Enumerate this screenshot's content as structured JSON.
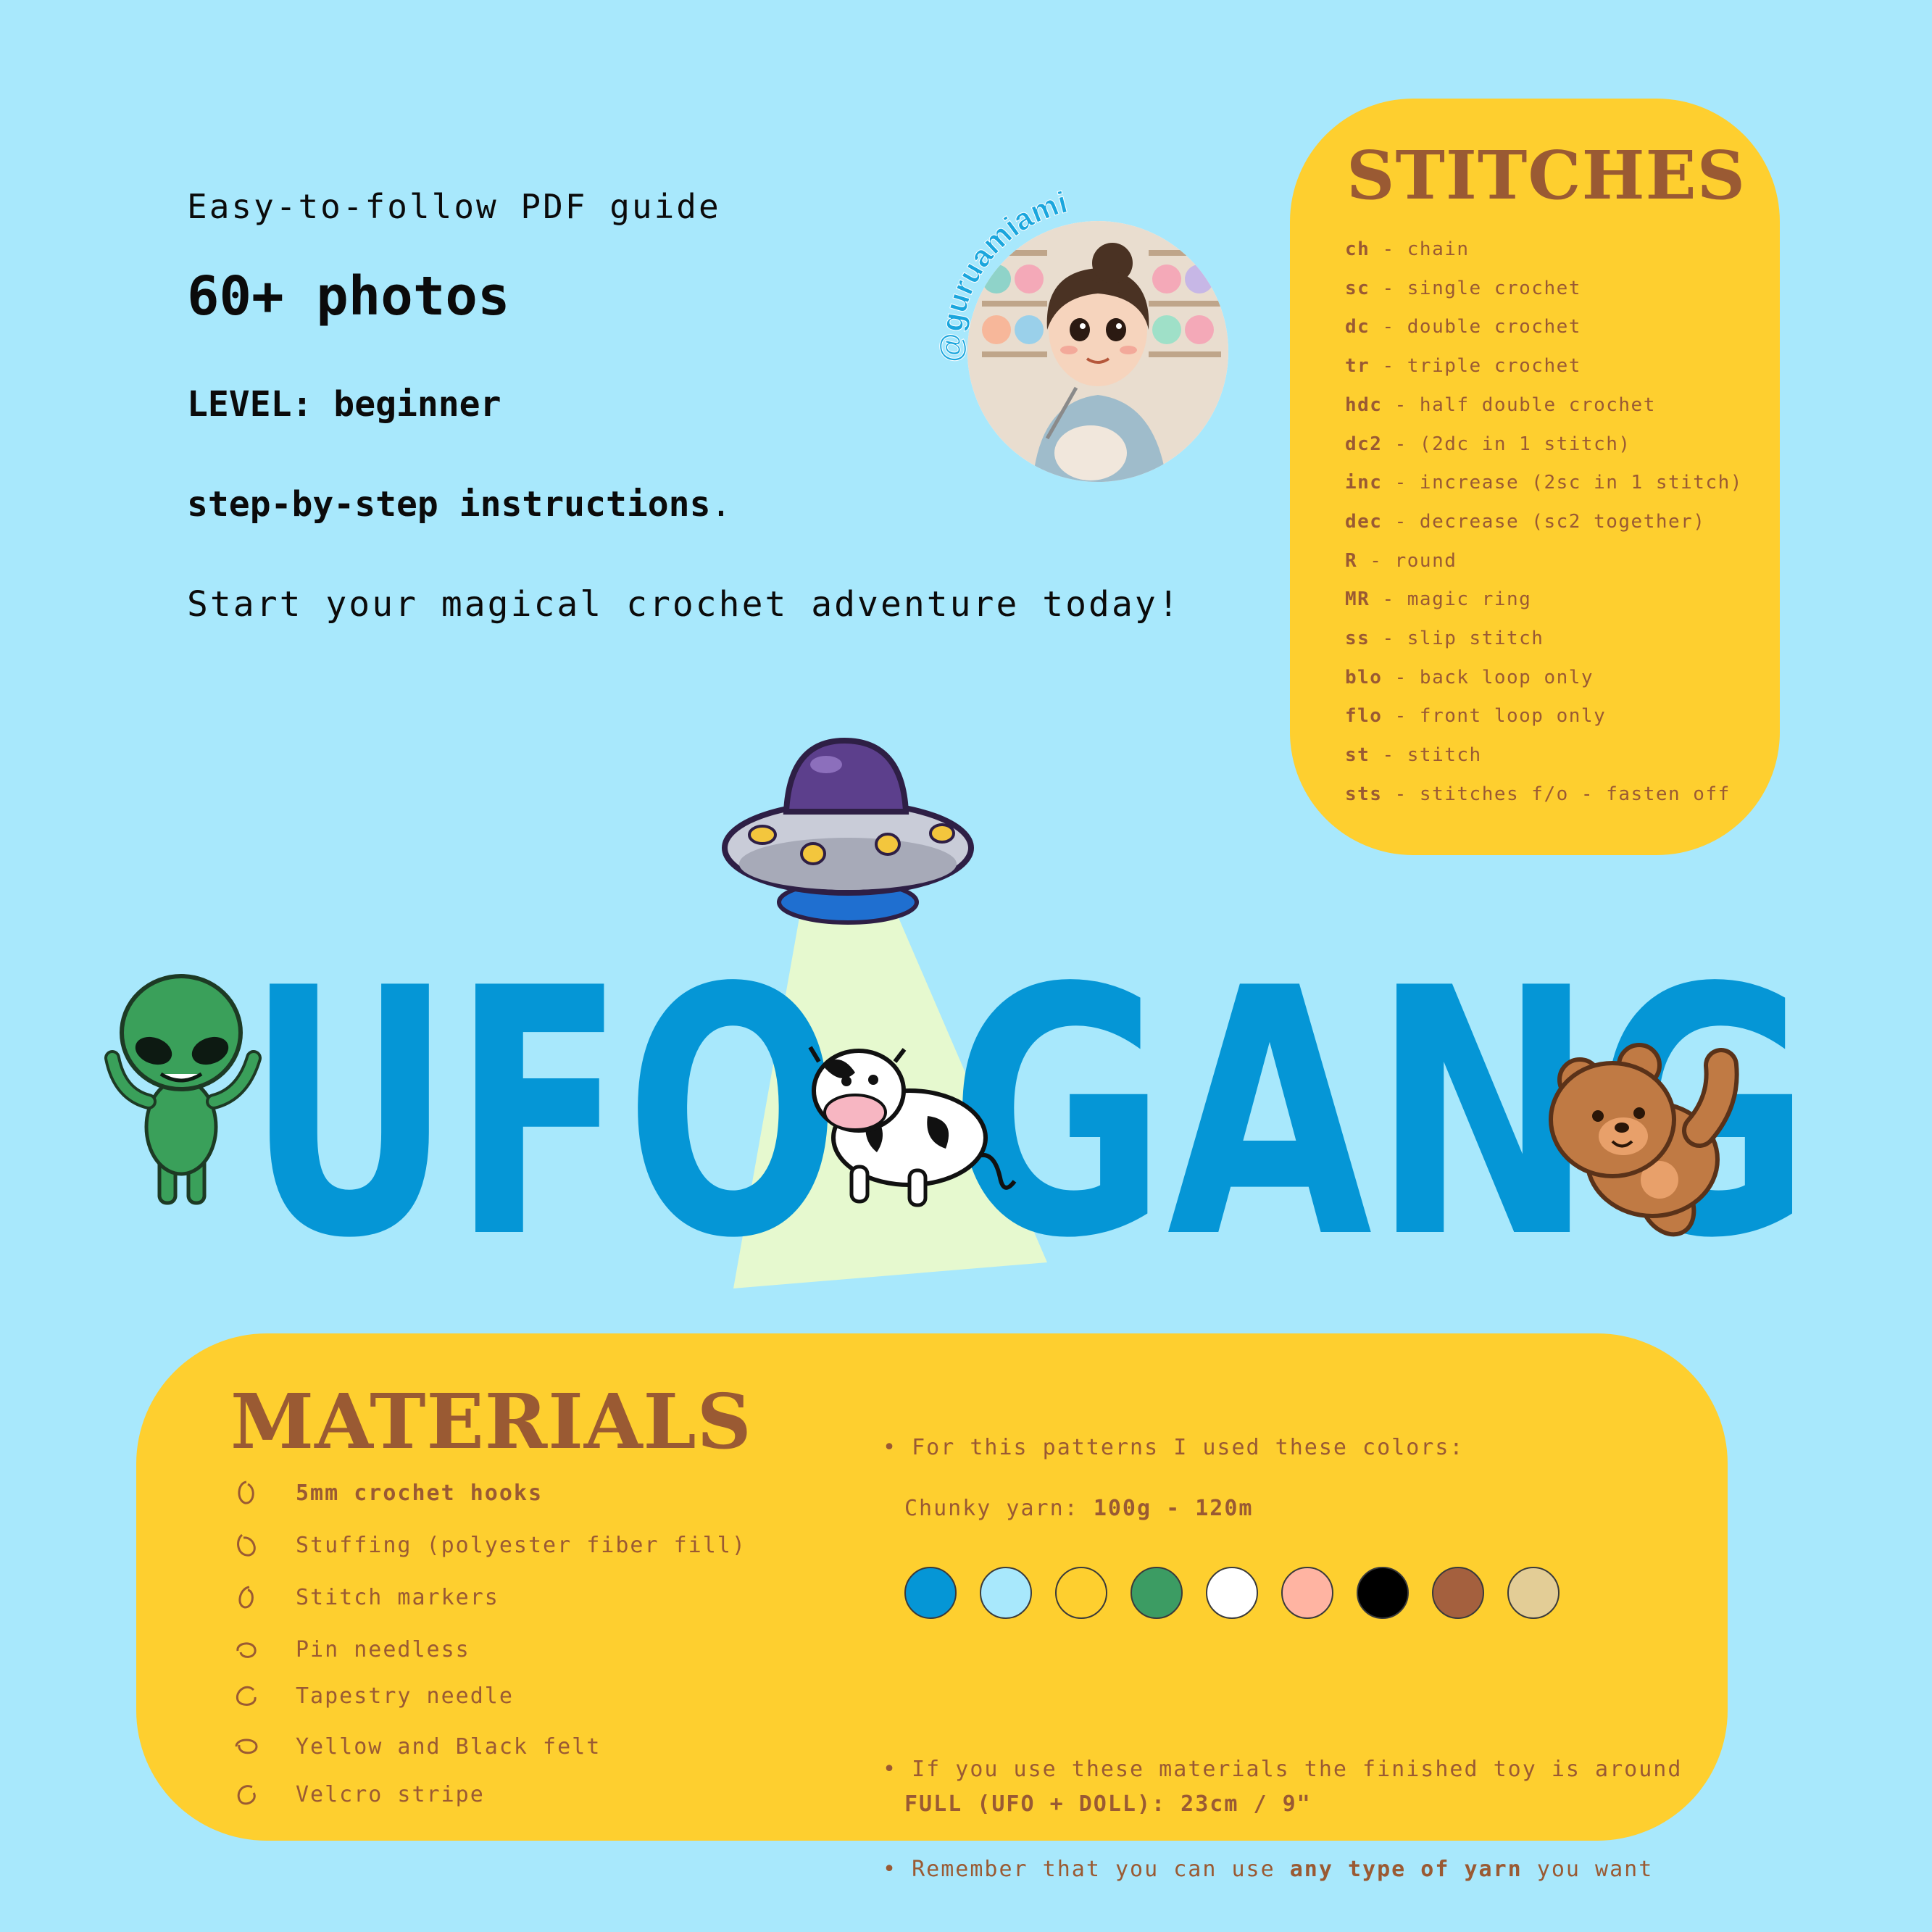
{
  "intro": {
    "line1": "Easy-to-follow PDF guide",
    "line2": "60+ photos",
    "line3": "LEVEL: beginner",
    "line4_bold": "step-by-step instructions",
    "line4_end": ".",
    "line5": "Start your magical crochet adventure today!"
  },
  "avatar": {
    "handle": "@guruamiami"
  },
  "stitches": {
    "title": "STITCHES",
    "items": [
      {
        "abbr": "ch",
        "desc": " - chain"
      },
      {
        "abbr": "sc",
        "desc": " - single crochet"
      },
      {
        "abbr": "dc",
        "desc": " - double crochet"
      },
      {
        "abbr": "tr",
        "desc": " - triple crochet"
      },
      {
        "abbr": "hdc",
        "desc": " - half double crochet"
      },
      {
        "abbr": "dc2",
        "desc": " - (2dc in 1 stitch)"
      },
      {
        "abbr": "inc",
        "desc": " - increase (2sc in 1 stitch)"
      },
      {
        "abbr": "dec",
        "desc": " - decrease (sc2 together)"
      },
      {
        "abbr": "R",
        "desc": " - round"
      },
      {
        "abbr": "MR",
        "desc": " - magic ring"
      },
      {
        "abbr": "ss",
        "desc": " - slip stitch"
      },
      {
        "abbr": "blo",
        "desc": " - back loop only"
      },
      {
        "abbr": "flo",
        "desc": " - front loop only"
      },
      {
        "abbr": "st",
        "desc": " - stitch"
      },
      {
        "abbr": "sts",
        "desc": " - stitches f/o - fasten off"
      }
    ]
  },
  "logo": {
    "word1": "UFO",
    "word2": "GANG"
  },
  "materials": {
    "title": "MATERIALS",
    "items": [
      "5mm crochet hooks",
      "Stuffing (polyester fiber fill)",
      "Stitch markers",
      "Pin needless",
      "Tapestry needle",
      "Yellow and Black felt",
      "Velcro stripe"
    ],
    "colors_intro": "For this patterns I used these colors:",
    "yarn_label": "Chunky yarn: ",
    "yarn_value": "100g - 120m",
    "colors": [
      "#0596d6",
      "#a8e8fc",
      "#fecf2f",
      "#3c9c63",
      "#ffffff",
      "#ffb4a2",
      "#000000",
      "#a4603e",
      "#e3cd96"
    ],
    "size_text": "If you use these materials the finished toy is around",
    "size_value": "FULL (UFO + DOLL): 23cm / 9\"",
    "yarn_note_start": "Remember that you can use ",
    "yarn_note_bold": "any type of yarn",
    "yarn_note_end": " you want"
  },
  "palette": {
    "background": "#a8e8fc",
    "panel": "#fecf2f",
    "brown": "#9a5a33",
    "logo_blue": "#0596d6"
  }
}
